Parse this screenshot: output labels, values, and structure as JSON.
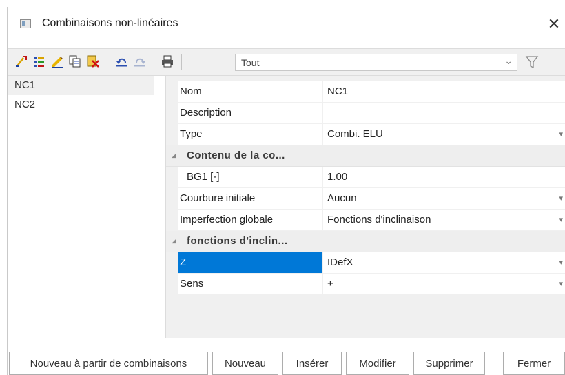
{
  "window": {
    "title": "Combinaisons non-linéaires",
    "close_glyph": "✕"
  },
  "toolbar": {
    "icons": [
      "new-combination-icon",
      "list-edit-icon",
      "edit-pencil-icon",
      "copy-icon",
      "delete-icon",
      "undo-icon",
      "redo-icon",
      "print-icon"
    ],
    "filter_value": "Tout",
    "filter_icon": "funnel-icon"
  },
  "list": {
    "items": [
      "NC1",
      "NC2"
    ],
    "selected": "NC1"
  },
  "properties": {
    "nom": {
      "label": "Nom",
      "value": "NC1"
    },
    "description": {
      "label": "Description",
      "value": ""
    },
    "type": {
      "label": "Type",
      "value": "Combi. ELU"
    },
    "contenu": {
      "label": "Contenu de la co..."
    },
    "bg1": {
      "label": "BG1 [-]",
      "value": "1.00"
    },
    "courbure": {
      "label": "Courbure initiale",
      "value": "Aucun"
    },
    "imperfection": {
      "label": "Imperfection globale",
      "value": "Fonctions d'inclinaison"
    },
    "fonctions": {
      "label": "fonctions d'inclin..."
    },
    "z": {
      "label": "Z",
      "value": "IDefX"
    },
    "sens": {
      "label": "Sens",
      "value": "+"
    }
  },
  "buttons": {
    "nouveau_combinaisons": "Nouveau à partir de combinaisons",
    "nouveau": "Nouveau",
    "inserer": "Insérer",
    "modifier": "Modifier",
    "supprimer": "Supprimer",
    "fermer": "Fermer"
  },
  "colors": {
    "selection": "#0078d7",
    "toolbar_bg": "#f0f0f0",
    "grid_bg": "#f0f0f0"
  }
}
